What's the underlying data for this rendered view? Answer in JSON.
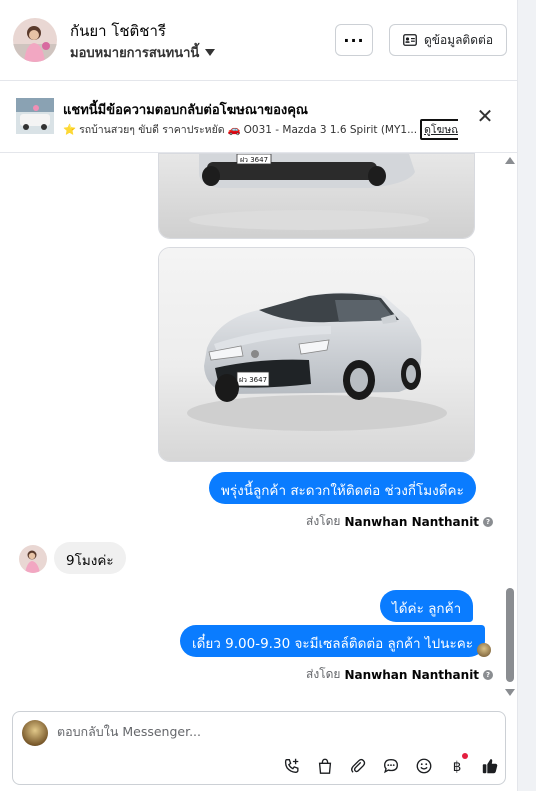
{
  "header": {
    "contact_name": "กันยา โชติชารี",
    "assign_label": "มอบหมายการสนทนานี้",
    "more_label": "···",
    "contact_info_label": "ดูข้อมูลติดต่อ"
  },
  "ad_banner": {
    "title": "แชทนี้มีข้อความตอบกลับต่อโฆษณาของคุณ",
    "star": "⭐",
    "subtitle": "รถบ้านสวยๆ ขับดี ราคาประหยัด",
    "car_emoji": "🚗",
    "ad_name": "O031 - Mazda 3 1.6 Spirit (MY1...",
    "link_label": "ดูโฆษณา"
  },
  "messages": [
    {
      "direction": "out",
      "text": "พรุ่งนี้ลูกค้า สะดวกให้ติดต่อ ช่วงกี่โมงดีคะ"
    },
    {
      "direction": "in",
      "text": "9โมงค่ะ"
    },
    {
      "direction": "out",
      "text": "ได้ค่ะ  ลูกค้า"
    },
    {
      "direction": "out",
      "text": "เดี๋ยว 9.00-9.30 จะมีเซลล์ติดต่อ ลูกค้า ไปนะคะ"
    }
  ],
  "sent_by": {
    "prefix": "ส่งโดย",
    "name": "Nanwhan Nanthanit"
  },
  "plate_text": "ฝว 3647",
  "composer": {
    "placeholder": "ตอบกลับใน Messenger..."
  },
  "icons": [
    "phone-plus-icon",
    "shopping-bag-icon",
    "paperclip-icon",
    "chat-bubble-icon",
    "smiley-icon",
    "baht-icon",
    "thumbs-up-icon",
    "close-icon",
    "contact-card-icon",
    "caret-down-icon"
  ],
  "colors": {
    "outgoing_bubble": "#0a7cff",
    "incoming_bubble": "#f0f0f0",
    "scrollbar": "#8a8d91",
    "notification_dot": "#e41e3f"
  }
}
